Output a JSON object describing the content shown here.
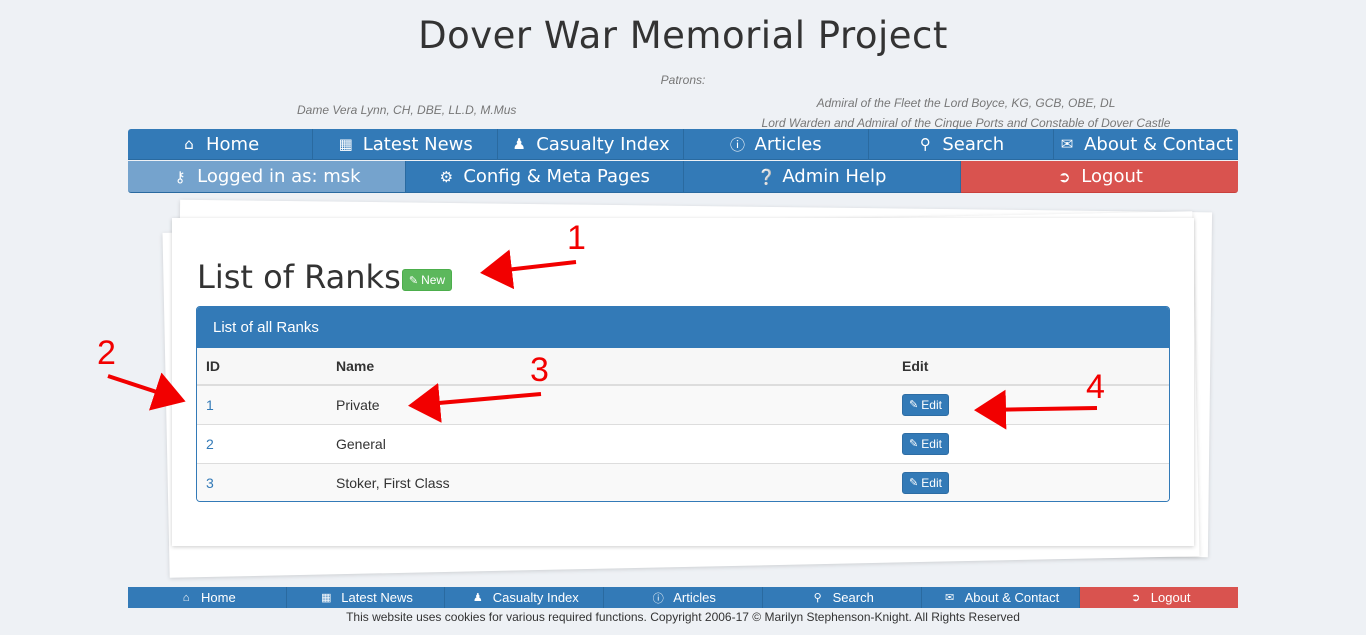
{
  "site": {
    "title": "Dover War Memorial Project",
    "patrons_label": "Patrons:",
    "patron_left": "Dame Vera Lynn, CH, DBE, LL.D, M.Mus",
    "patron_right_line1": "Admiral of the Fleet the Lord Boyce, KG, GCB, OBE, DL",
    "patron_right_line2": "Lord Warden and Admiral of the Cinque Ports and Constable of Dover Castle"
  },
  "nav_main": [
    {
      "label": "Home",
      "icon": "home-icon"
    },
    {
      "label": "Latest News",
      "icon": "calendar-icon"
    },
    {
      "label": "Casualty Index",
      "icon": "users-icon"
    },
    {
      "label": "Articles",
      "icon": "info-icon"
    },
    {
      "label": "Search",
      "icon": "search-icon"
    },
    {
      "label": "About & Contact",
      "icon": "envelope-icon"
    }
  ],
  "nav_admin": [
    {
      "label": "Logged in as: msk",
      "icon": "key-icon"
    },
    {
      "label": "Config & Meta Pages",
      "icon": "cogs-icon"
    },
    {
      "label": "Admin Help",
      "icon": "question-icon"
    },
    {
      "label": "Logout",
      "icon": "logout-icon"
    }
  ],
  "page": {
    "heading": "List of Ranks",
    "new_label": "New",
    "panel_title": "List of all Ranks",
    "columns": [
      "ID",
      "Name",
      "Edit"
    ],
    "edit_label": "Edit",
    "rows": [
      {
        "id": "1",
        "name": "Private"
      },
      {
        "id": "2",
        "name": "General"
      },
      {
        "id": "3",
        "name": "Stoker, First Class"
      }
    ]
  },
  "annotations": [
    "1",
    "2",
    "3",
    "4"
  ],
  "annotation_color": "#f20000",
  "footer_nav": [
    {
      "label": "Home",
      "icon": "home-icon"
    },
    {
      "label": "Latest News",
      "icon": "calendar-icon"
    },
    {
      "label": "Casualty Index",
      "icon": "users-icon"
    },
    {
      "label": "Articles",
      "icon": "info-icon"
    },
    {
      "label": "Search",
      "icon": "search-icon"
    },
    {
      "label": "About & Contact",
      "icon": "envelope-icon"
    },
    {
      "label": "Logout",
      "icon": "logout-icon"
    }
  ],
  "copyright": "This website uses cookies for various required functions. Copyright 2006-17 © Marilyn Stephenson-Knight. All Rights Reserved"
}
